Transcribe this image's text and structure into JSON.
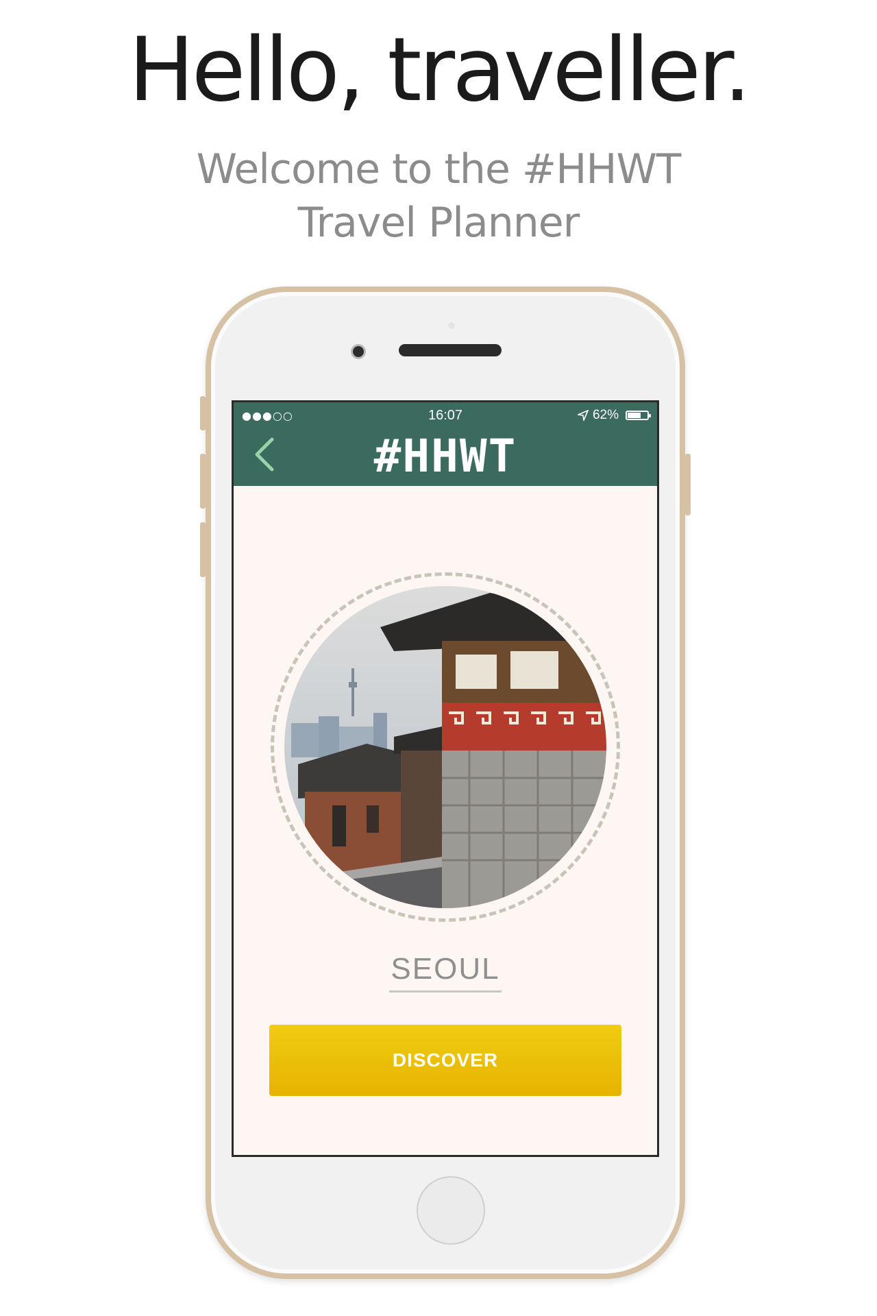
{
  "headline": "Hello, traveller.",
  "subtitle": {
    "line1": "Welcome to the #HHWT",
    "line2": "Travel Planner"
  },
  "status_bar": {
    "signal": "●●●○○",
    "time": "16:07",
    "battery_percent": "62%",
    "location_icon": "location-arrow-icon"
  },
  "app": {
    "logo": "#HHWT",
    "back_icon": "chevron-left-icon",
    "header_color": "#3b6a5e",
    "background_color": "#fdf6f3"
  },
  "destination": {
    "name": "SEOUL"
  },
  "actions": {
    "discover_label": "DISCOVER",
    "button_color": "#ecc00b"
  }
}
